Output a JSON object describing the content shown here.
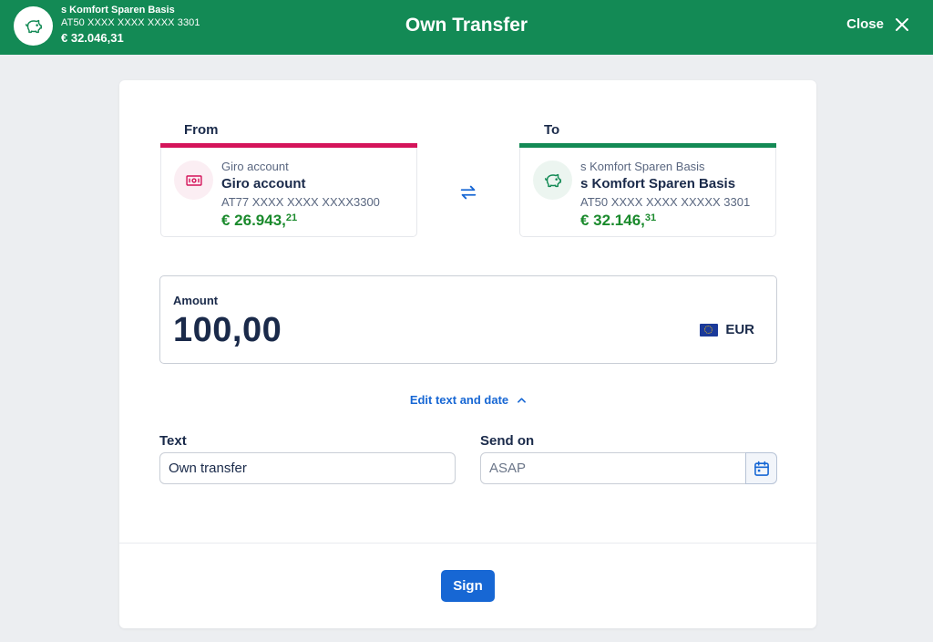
{
  "header": {
    "account_name": "s Komfort Sparen Basis",
    "account_iban": "AT50 XXXX XXXX XXXX 3301",
    "account_balance": "€ 32.046,31",
    "title": "Own Transfer",
    "close_label": "Close"
  },
  "from": {
    "label": "From",
    "type": "Giro account",
    "name": "Giro account",
    "iban": "AT77 XXXX XXXX XXXX3300",
    "balance_main": "€ 26.943,",
    "balance_cents": "21",
    "color": "#d4145a"
  },
  "to": {
    "label": "To",
    "type": "s Komfort Sparen Basis",
    "name": "s Komfort Sparen Basis",
    "iban": "AT50 XXXX XXXX XXXXX 3301",
    "balance_main": "€ 32.146,",
    "balance_cents": "31",
    "color": "#138a55"
  },
  "amount": {
    "label": "Amount",
    "value": "100,00",
    "currency": "EUR"
  },
  "edit_link": "Edit text and date",
  "text_field": {
    "label": "Text",
    "value": "Own transfer"
  },
  "send_on": {
    "label": "Send on",
    "placeholder": "ASAP"
  },
  "sign_label": "Sign",
  "icons": {
    "header_account": "piggy-bank-icon",
    "from_account": "banknote-icon",
    "to_account": "piggy-bank-icon",
    "swap": "swap-arrows-icon",
    "close": "close-icon",
    "calendar": "calendar-icon",
    "chevron": "chevron-up-icon"
  }
}
